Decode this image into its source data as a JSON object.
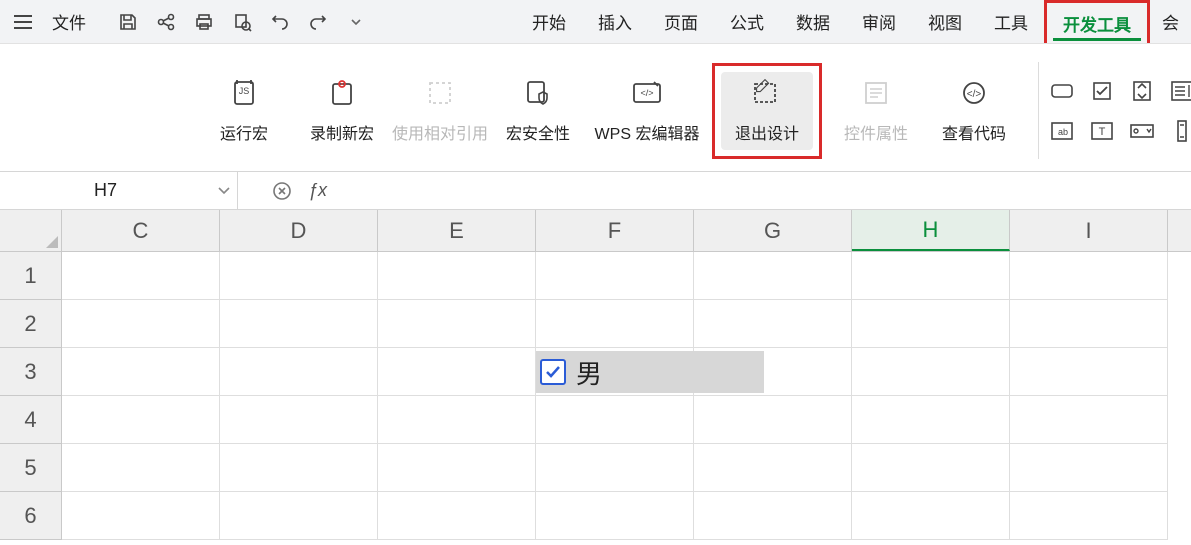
{
  "menubar": {
    "file_label": "文件",
    "tabs": [
      "开始",
      "插入",
      "页面",
      "公式",
      "数据",
      "审阅",
      "视图",
      "工具",
      "开发工具"
    ],
    "partial_tab": "会",
    "active_tab_index": 8
  },
  "ribbon": {
    "run_macro": "运行宏",
    "record_macro": "录制新宏",
    "relative_ref": "使用相对引用",
    "macro_security": "宏安全性",
    "wps_macro_editor": "WPS 宏编辑器",
    "exit_design": "退出设计",
    "control_props": "控件属性",
    "view_code": "查看代码"
  },
  "formula_bar": {
    "cell_ref": "H7"
  },
  "grid": {
    "columns": [
      "C",
      "D",
      "E",
      "F",
      "G",
      "H",
      "I"
    ],
    "rows": [
      "1",
      "2",
      "3",
      "4",
      "5",
      "6"
    ],
    "active_column": "H",
    "checkbox_label": "男"
  }
}
